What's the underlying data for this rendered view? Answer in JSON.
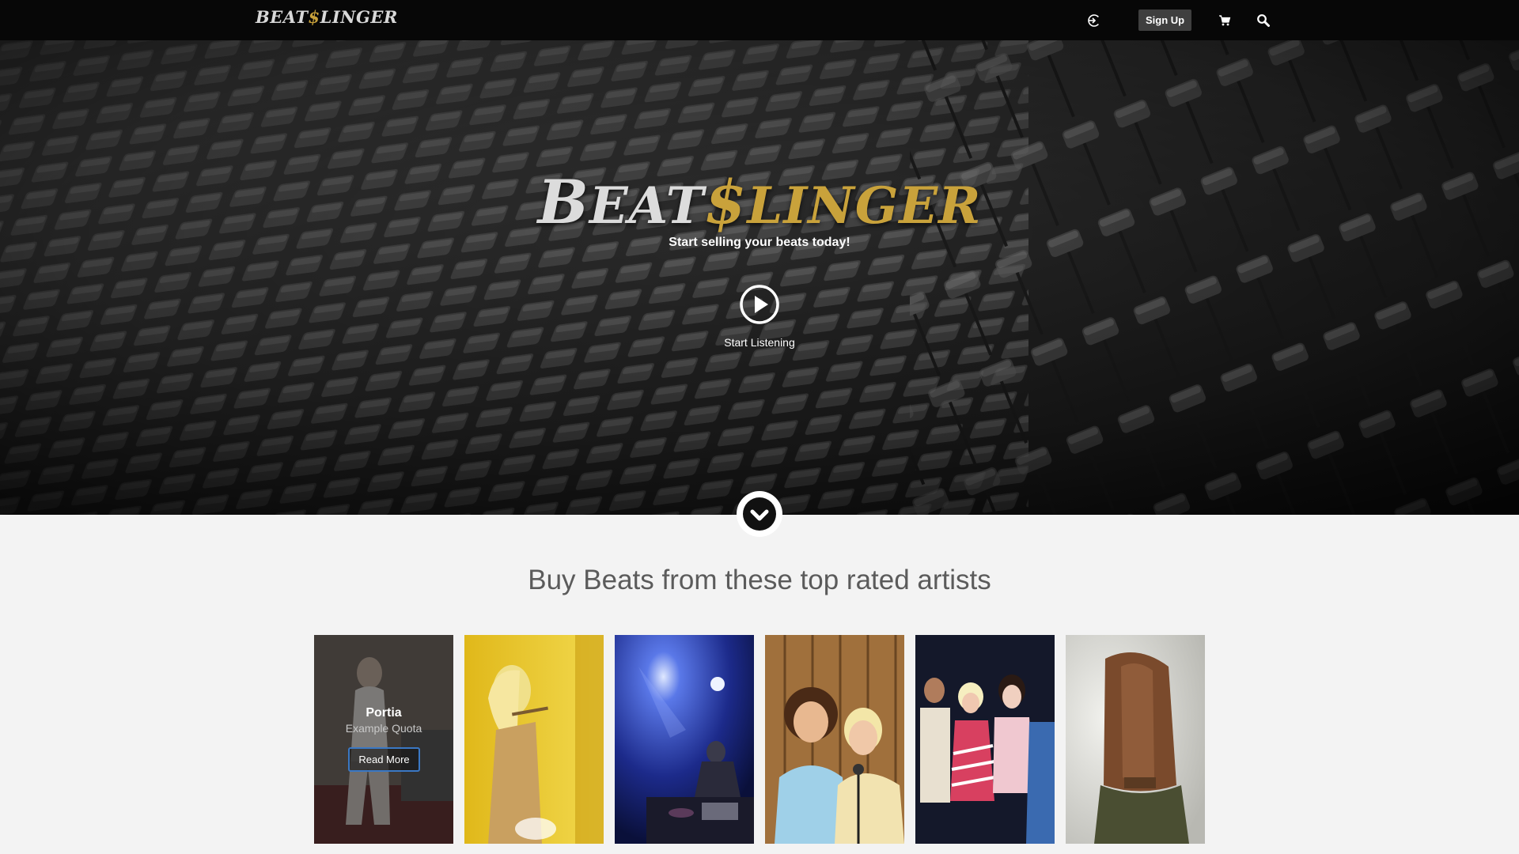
{
  "nav": {
    "logo_part1": "BEAT",
    "logo_dollar": "$",
    "logo_part2": "LINGER",
    "signup_label": "Sign Up"
  },
  "hero": {
    "logo_b": "B",
    "logo_eat": "EAT",
    "logo_dollar": "$",
    "logo_linger": "LINGER",
    "tagline": "Start selling your beats today!",
    "listen_label": "Start Listening"
  },
  "artists_section": {
    "title": "Buy Beats from these top rated artists",
    "featured": {
      "name": "Portia",
      "quote": "Example Quota",
      "button": "Read More"
    }
  },
  "colors": {
    "nav_bg": "#070707",
    "gold": "#c9a23b",
    "button_border": "#3a78c4",
    "section_bg": "#f3f3f3"
  }
}
